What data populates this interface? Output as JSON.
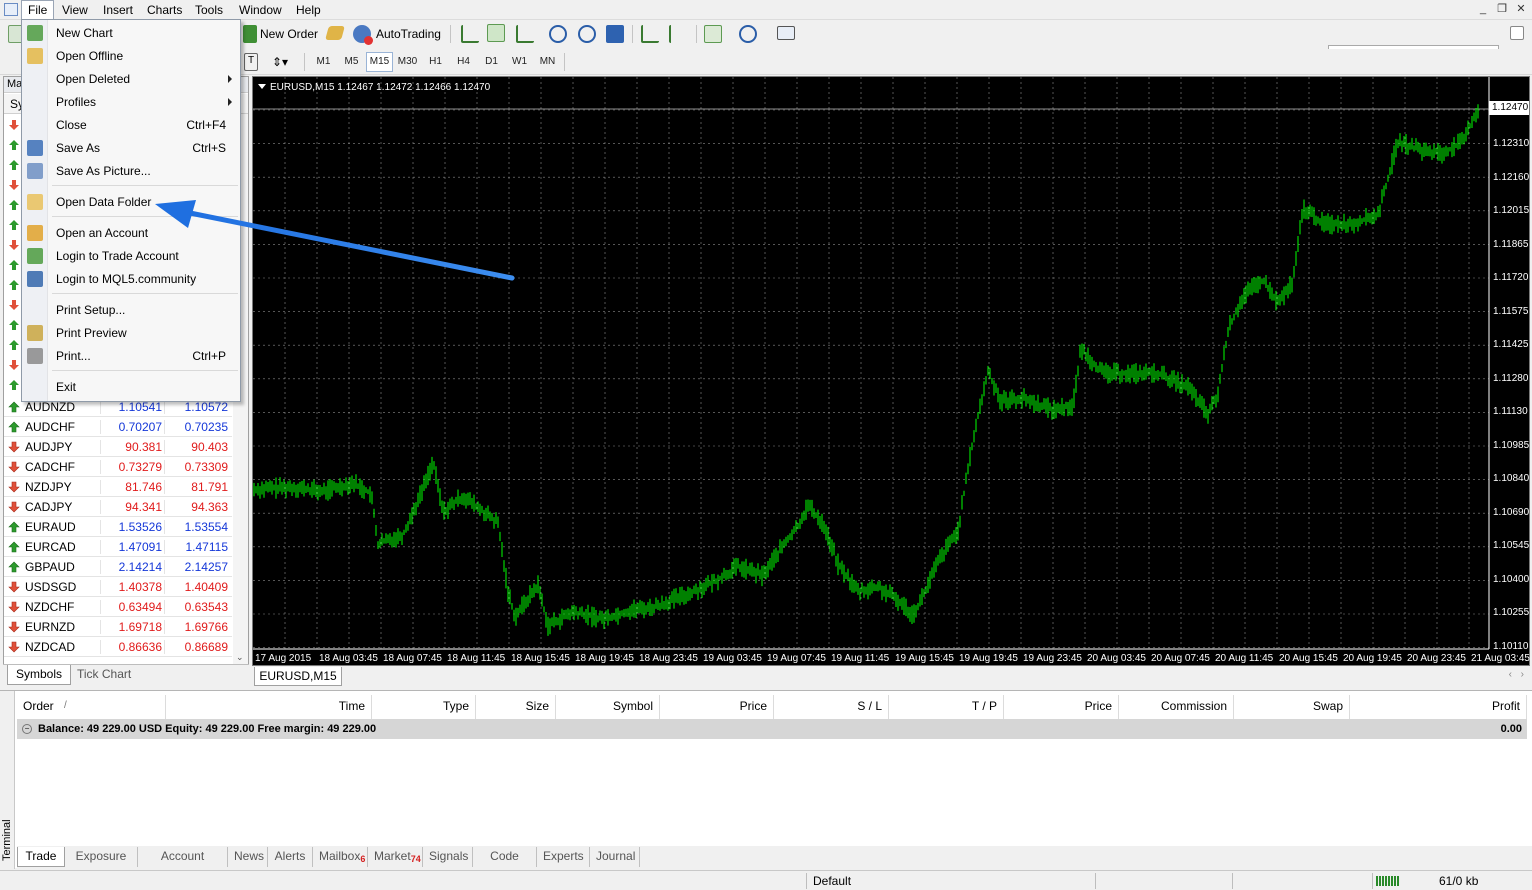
{
  "menubar": {
    "items": [
      "File",
      "View",
      "Insert",
      "Charts",
      "Tools",
      "Window",
      "Help"
    ]
  },
  "toolbar": {
    "new_order": "New Order",
    "autotrading": "AutoTrading",
    "timeframes": [
      "M1",
      "M5",
      "M15",
      "M30",
      "H1",
      "H4",
      "D1",
      "W1",
      "MN"
    ],
    "active_timeframe": "M15",
    "search_placeholder": ""
  },
  "file_menu": {
    "items": [
      {
        "label": "New Chart",
        "shortcut": "",
        "icon": "new-chart-icon"
      },
      {
        "label": "Open Offline",
        "shortcut": "",
        "icon": "open-offline-icon"
      },
      {
        "label": "Open Deleted",
        "shortcut": "",
        "submenu": true
      },
      {
        "label": "Profiles",
        "shortcut": "",
        "submenu": true
      },
      {
        "label": "Close",
        "shortcut": "Ctrl+F4"
      },
      {
        "label": "Save As",
        "shortcut": "Ctrl+S",
        "icon": "save-icon"
      },
      {
        "label": "Save As Picture...",
        "shortcut": "",
        "icon": "picture-icon"
      },
      {
        "label": "Open Data Folder",
        "shortcut": "",
        "icon": "folder-icon"
      },
      {
        "label": "Open an Account",
        "shortcut": "",
        "icon": "account-icon"
      },
      {
        "label": "Login to Trade Account",
        "shortcut": "",
        "icon": "login-icon"
      },
      {
        "label": "Login to MQL5.community",
        "shortcut": "",
        "icon": "mql5-icon"
      },
      {
        "label": "Print Setup...",
        "shortcut": ""
      },
      {
        "label": "Print Preview",
        "shortcut": "",
        "icon": "print-preview-icon"
      },
      {
        "label": "Print...",
        "shortcut": "Ctrl+P",
        "icon": "printer-icon"
      },
      {
        "label": "Exit",
        "shortcut": ""
      }
    ]
  },
  "market_watch": {
    "header": "Ma",
    "col_symbol": "Sy",
    "rows": [
      {
        "symbol": "AUDNZD",
        "bid": "1.10541",
        "ask": "1.10572",
        "dir": "up",
        "color": "blue"
      },
      {
        "symbol": "AUDCHF",
        "bid": "0.70207",
        "ask": "0.70235",
        "dir": "up",
        "color": "blue"
      },
      {
        "symbol": "AUDJPY",
        "bid": "90.381",
        "ask": "90.403",
        "dir": "down",
        "color": "red"
      },
      {
        "symbol": "CADCHF",
        "bid": "0.73279",
        "ask": "0.73309",
        "dir": "down",
        "color": "red"
      },
      {
        "symbol": "NZDJPY",
        "bid": "81.746",
        "ask": "81.791",
        "dir": "down",
        "color": "red"
      },
      {
        "symbol": "CADJPY",
        "bid": "94.341",
        "ask": "94.363",
        "dir": "down",
        "color": "red"
      },
      {
        "symbol": "EURAUD",
        "bid": "1.53526",
        "ask": "1.53554",
        "dir": "up",
        "color": "blue"
      },
      {
        "symbol": "EURCAD",
        "bid": "1.47091",
        "ask": "1.47115",
        "dir": "up",
        "color": "blue"
      },
      {
        "symbol": "GBPAUD",
        "bid": "2.14214",
        "ask": "2.14257",
        "dir": "up",
        "color": "blue"
      },
      {
        "symbol": "USDSGD",
        "bid": "1.40378",
        "ask": "1.40409",
        "dir": "down",
        "color": "red"
      },
      {
        "symbol": "NZDCHF",
        "bid": "0.63494",
        "ask": "0.63543",
        "dir": "down",
        "color": "red"
      },
      {
        "symbol": "EURNZD",
        "bid": "1.69718",
        "ask": "1.69766",
        "dir": "down",
        "color": "red"
      },
      {
        "symbol": "NZDCAD",
        "bid": "0.86636",
        "ask": "0.86689",
        "dir": "down",
        "color": "red"
      }
    ],
    "tabs": [
      "Symbols",
      "Tick Chart"
    ]
  },
  "chart": {
    "title": "EURUSD,M15  1.12467 1.12472 1.12466 1.12470",
    "current_price": "1.12470",
    "y_ticks": [
      "1.12310",
      "1.12160",
      "1.12015",
      "1.11865",
      "1.11720",
      "1.11575",
      "1.11425",
      "1.11280",
      "1.11130",
      "1.10985",
      "1.10840",
      "1.10690",
      "1.10545",
      "1.10400",
      "1.10255",
      "1.10110"
    ],
    "x_ticks": [
      "17 Aug 2015",
      "18 Aug 03:45",
      "18 Aug 07:45",
      "18 Aug 11:45",
      "18 Aug 15:45",
      "18 Aug 19:45",
      "18 Aug 23:45",
      "19 Aug 03:45",
      "19 Aug 07:45",
      "19 Aug 11:45",
      "19 Aug 15:45",
      "19 Aug 19:45",
      "19 Aug 23:45",
      "20 Aug 03:45",
      "20 Aug 07:45",
      "20 Aug 11:45",
      "20 Aug 15:45",
      "20 Aug 19:45",
      "20 Aug 23:45",
      "21 Aug 03:45"
    ],
    "tab_label": "EURUSD,M15",
    "colors": {
      "background": "#000000",
      "candles": "#00ff00",
      "grid": "#ffffff"
    }
  },
  "terminal": {
    "side_label": "Terminal",
    "columns": [
      "Order",
      "Time",
      "Type",
      "Size",
      "Symbol",
      "Price",
      "S / L",
      "T / P",
      "Price",
      "Commission",
      "Swap",
      "Profit"
    ],
    "balance_text": "Balance: 49 229.00 USD  Equity: 49 229.00  Free margin: 49 229.00",
    "profit_total": "0.00",
    "tabs": [
      {
        "label": "Trade",
        "badge": ""
      },
      {
        "label": "Exposure",
        "badge": ""
      },
      {
        "label": "Account History",
        "badge": ""
      },
      {
        "label": "News",
        "badge": ""
      },
      {
        "label": "Alerts",
        "badge": ""
      },
      {
        "label": "Mailbox",
        "badge": "6"
      },
      {
        "label": "Market",
        "badge": "74"
      },
      {
        "label": "Signals",
        "badge": ""
      },
      {
        "label": "Code Base",
        "badge": ""
      },
      {
        "label": "Experts",
        "badge": ""
      },
      {
        "label": "Journal",
        "badge": ""
      }
    ]
  },
  "statusbar": {
    "profile": "Default",
    "traffic": "61/0 kb"
  }
}
